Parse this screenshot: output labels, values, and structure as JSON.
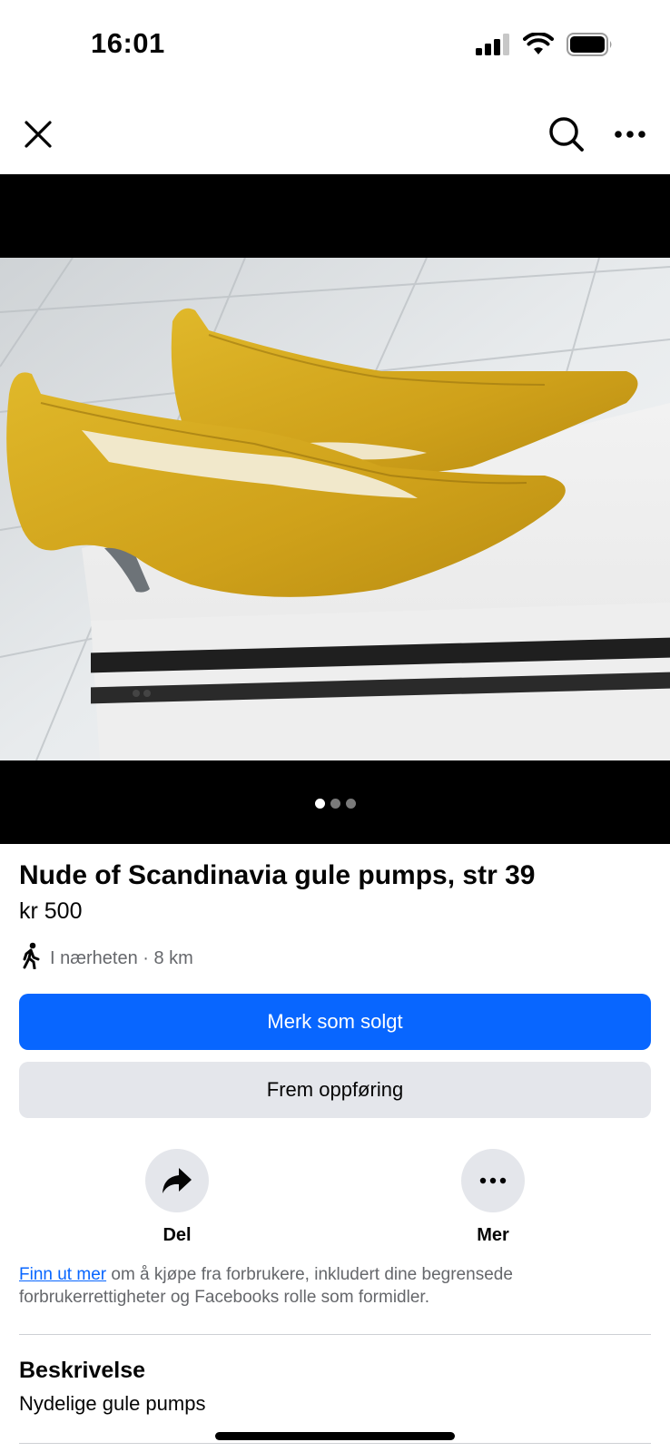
{
  "status_bar": {
    "time": "16:01",
    "icons": [
      "signal-icon",
      "wifi-icon",
      "battery-icon"
    ]
  },
  "nav": {
    "icons": [
      "close-icon",
      "search-icon",
      "more-icon"
    ]
  },
  "gallery": {
    "image": "yellow-suede-pumps-photo",
    "page_count": 3,
    "active_index": 0
  },
  "listing": {
    "title": "Nude of Scandinavia gule pumps, str 39",
    "price": "kr 500",
    "location": "I nærheten · 8 km"
  },
  "buttons": {
    "mark_sold": "Merk som solgt",
    "boost": "Frem oppføring"
  },
  "actions": {
    "share": "Del",
    "more": "Mer"
  },
  "info": {
    "link": "Finn ut mer",
    "text": " om å kjøpe fra forbrukere, inkludert dine begrensede forbrukerrettigheter og Facebooks rolle som formidler."
  },
  "description": {
    "heading": "Beskrivelse",
    "body": "Nydelige gule pumps"
  },
  "colors": {
    "primary": "#0866ff",
    "secondary_button": "#e4e6eb",
    "muted_text": "#65676b",
    "shoe": "#d9b01e"
  }
}
